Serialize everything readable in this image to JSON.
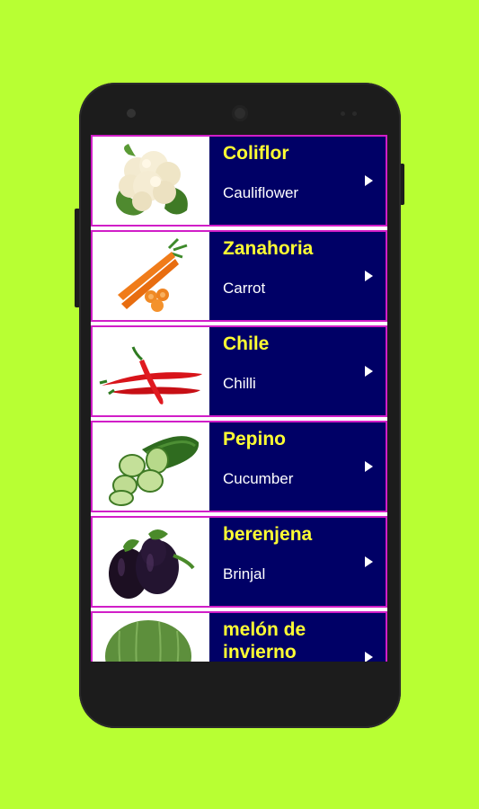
{
  "app": {
    "background_color": "#b8ff33",
    "row_background": "#000066",
    "row_border": "#d11ec8",
    "spanish_color": "#ffff33",
    "english_color": "#ffffff"
  },
  "vegetables": [
    {
      "spanish": "Coliflor",
      "english": "Cauliflower",
      "icon": "cauliflower-image"
    },
    {
      "spanish": "Zanahoria",
      "english": "Carrot",
      "icon": "carrot-image"
    },
    {
      "spanish": "Chile",
      "english": "Chilli",
      "icon": "chilli-image"
    },
    {
      "spanish": "Pepino",
      "english": "Cucumber",
      "icon": "cucumber-image"
    },
    {
      "spanish": "berenjena",
      "english": "Brinjal",
      "icon": "brinjal-image"
    },
    {
      "spanish": "melón de invierno",
      "english": "",
      "icon": "winter-melon-image"
    }
  ]
}
